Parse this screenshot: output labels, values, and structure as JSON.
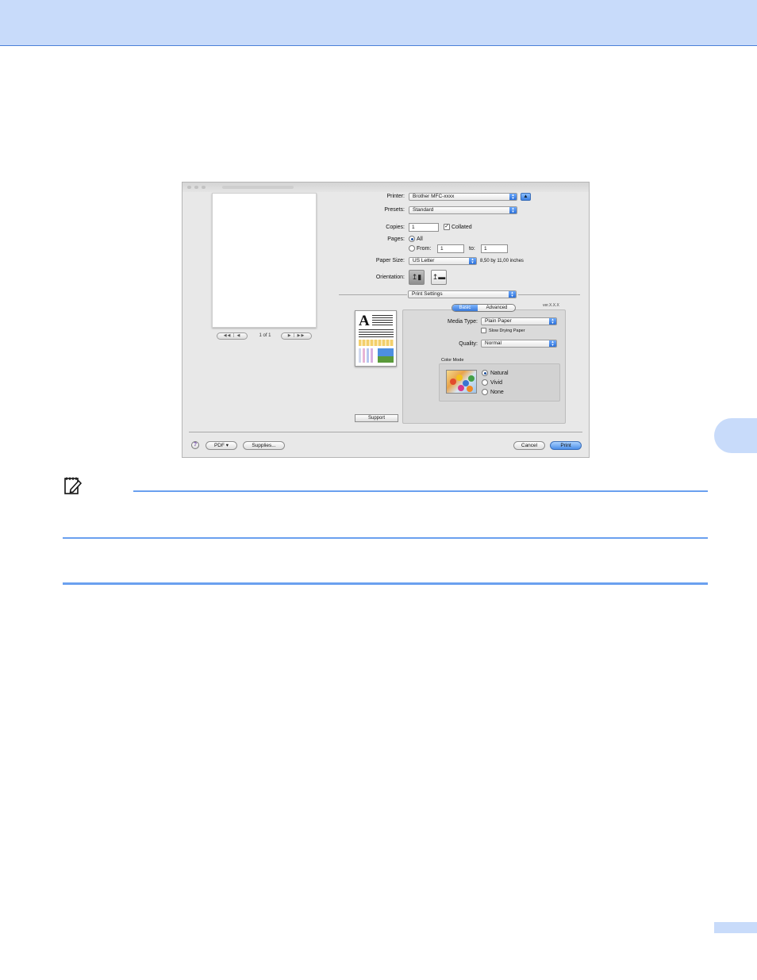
{
  "colors": {
    "band": "#c8dbfa",
    "accent_line": "#6aa0ef",
    "default_button": "#4b8ee8"
  },
  "printer": {
    "label": "Printer:",
    "value": "Brother MFC-xxxx"
  },
  "presets": {
    "label": "Presets:",
    "value": "Standard"
  },
  "copies": {
    "label": "Copies:",
    "value": "1",
    "collated_label": "Collated",
    "collated_checked": true
  },
  "pages": {
    "label": "Pages:",
    "all_label": "All",
    "from_label": "From:",
    "from_value": "1",
    "to_label": "to:",
    "to_value": "1",
    "selected": "All"
  },
  "paper_size": {
    "label": "Paper Size:",
    "value": "US Letter",
    "dimensions": "8,50 by 11,00 inches"
  },
  "orientation": {
    "label": "Orientation:",
    "selected": "portrait"
  },
  "panel_menu": {
    "value": "Print Settings"
  },
  "preview": {
    "page_counter": "1 of 1"
  },
  "tabs": {
    "basic": "Basic",
    "advanced": "Advanced",
    "selected": "Basic",
    "version": "ver.X.X.X"
  },
  "media_type": {
    "label": "Media Type:",
    "value": "Plain Paper",
    "slow_drying_label": "Slow Drying Paper",
    "slow_drying_checked": false
  },
  "quality": {
    "label": "Quality:",
    "value": "Normal"
  },
  "color_mode": {
    "title": "Color Mode",
    "options": [
      "Natural",
      "Vivid",
      "None"
    ],
    "selected": "Natural"
  },
  "buttons": {
    "support": "Support",
    "pdf": "PDF ▾",
    "supplies": "Supplies...",
    "cancel": "Cancel",
    "print": "Print",
    "help": "?"
  },
  "icons": {
    "note": "note-pencil-icon",
    "disclosure": "disclosure-up-icon",
    "orientation_portrait": "portrait-orientation-icon",
    "orientation_landscape": "landscape-orientation-icon"
  }
}
